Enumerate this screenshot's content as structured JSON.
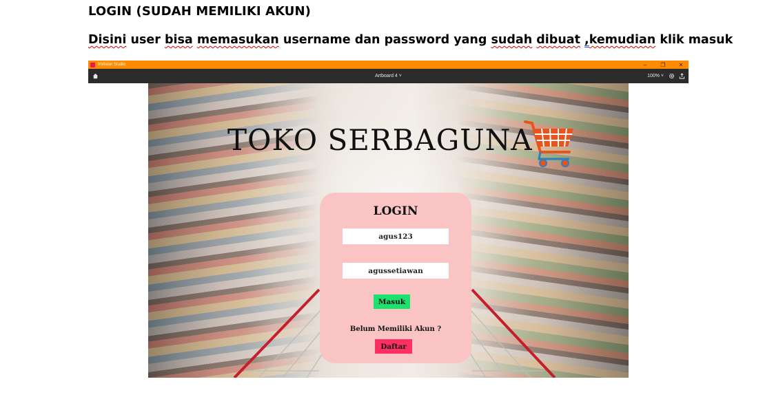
{
  "document": {
    "heading": "LOGIN (SUDAH MEMILIKI AKUN)",
    "description_parts": [
      "Disini",
      " user ",
      "bisa",
      " ",
      "memasukan",
      " username dan password yang ",
      "sudah",
      " ",
      "dibuat",
      " ",
      ",",
      "kemudian",
      " klik masuk"
    ]
  },
  "app": {
    "name": "InVision Studio",
    "artboard": "Artboard 4 ˅",
    "zoom": "100% ˅",
    "accent_color": "#ff8c00",
    "toolbar_color": "#2b2b2b",
    "window_controls": {
      "minimize": "–",
      "restore": "❐",
      "close": "✕"
    }
  },
  "screen": {
    "brand": "TOKO SERBAGUNA",
    "login": {
      "title": "LOGIN",
      "username_value": "agus123",
      "password_value": "agussetiawan",
      "submit_label": "Masuk",
      "no_account_text": "Belum Memiliki Akun ?",
      "register_label": "Daftar",
      "card_color": "#fbc4c4",
      "submit_color": "#1ee06c",
      "register_color": "#ff2f62"
    }
  }
}
